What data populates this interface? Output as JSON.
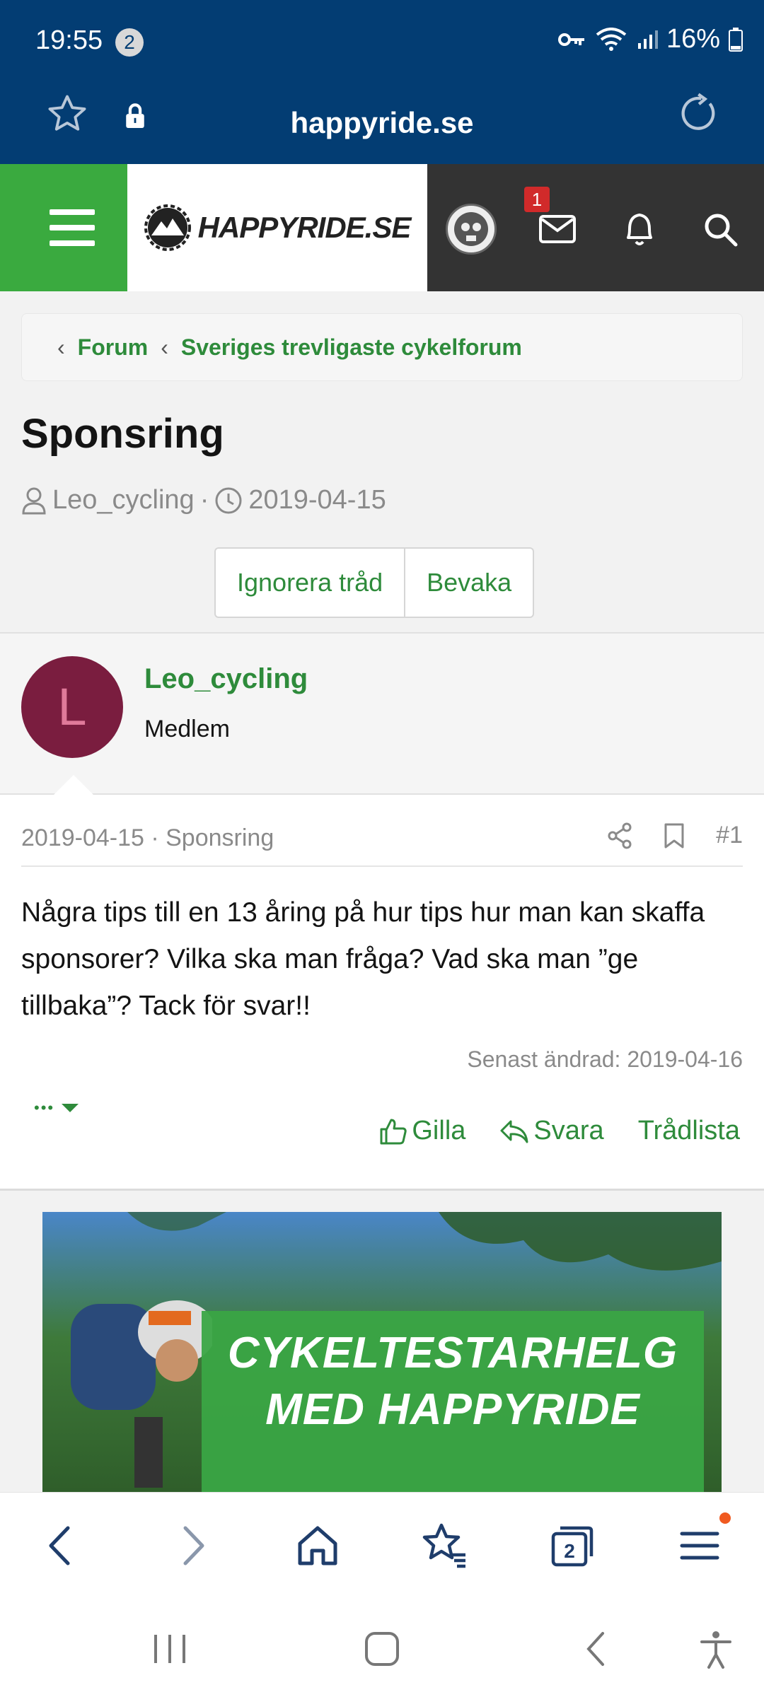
{
  "status": {
    "time": "19:55",
    "notification_count": "2",
    "battery": "16%"
  },
  "browser": {
    "url": "happyride.se"
  },
  "site": {
    "logo_text": "HAPPYRIDE.SE",
    "messages_badge": "1"
  },
  "breadcrumb": {
    "items": [
      "Forum",
      "Sveriges trevligaste cykelforum"
    ]
  },
  "thread": {
    "title": "Sponsring",
    "author": "Leo_cycling",
    "date": "2019-04-15",
    "ignore_label": "Ignorera tråd",
    "watch_label": "Bevaka"
  },
  "post": {
    "avatar_letter": "L",
    "username": "Leo_cycling",
    "role": "Medlem",
    "meta": "2019-04-15 · Sponsring",
    "number": "#1",
    "text": "Några tips till en 13 åring på hur tips hur man kan skaffa sponsorer? Vilka ska man fråga? Vad ska man ”ge tillbaka”? Tack för svar!!",
    "edited": "Senast ändrad: 2019-04-16",
    "like_label": "Gilla",
    "reply_label": "Svara",
    "threadlist_label": "Trådlista",
    "dots": "•••"
  },
  "ad": {
    "line1": "CYKELTESTARHELG",
    "line2": "MED HAPPYRIDE"
  },
  "colors": {
    "header_blue": "#033d73",
    "brand_green": "#3aaa3f",
    "link_green": "#2e8b3b",
    "avatar_bg": "#7a1d3f"
  }
}
